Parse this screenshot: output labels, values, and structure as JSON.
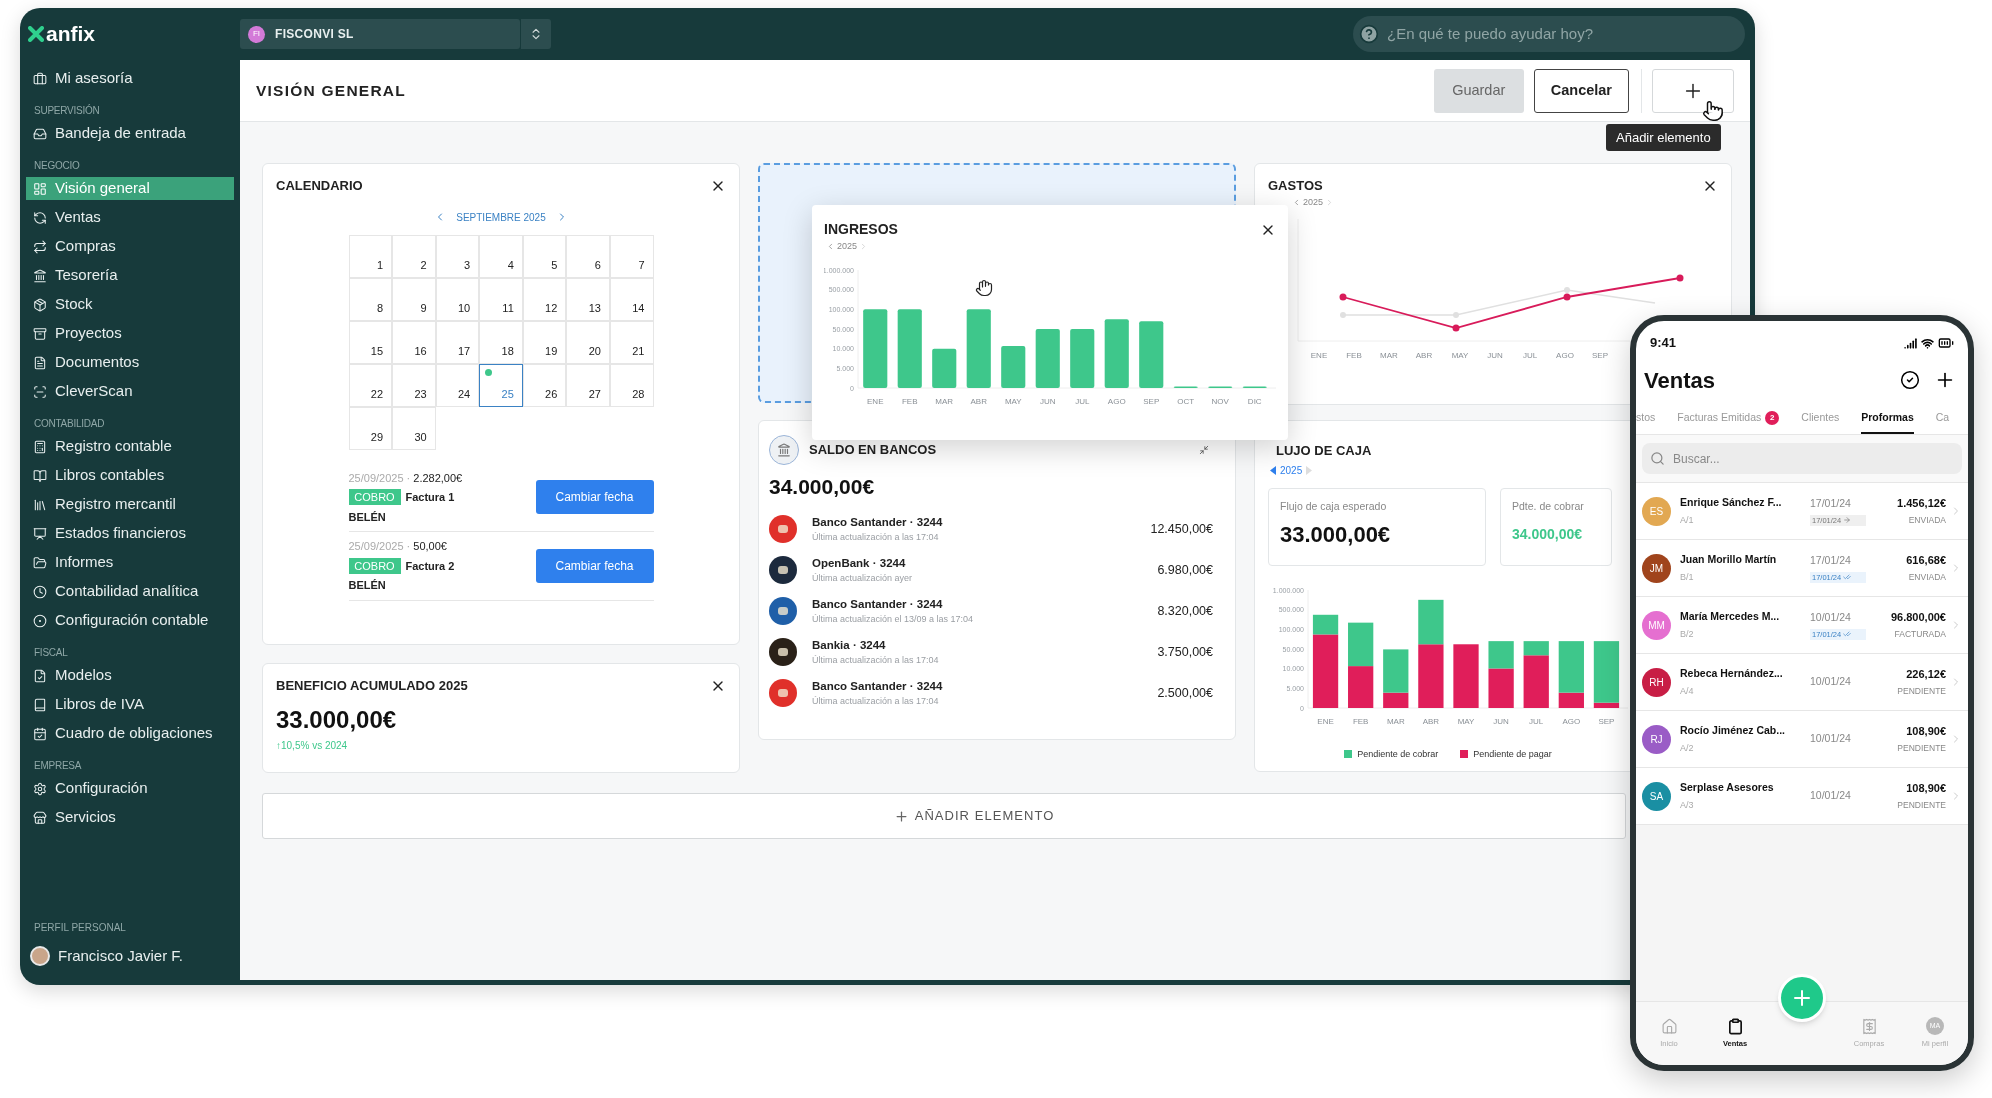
{
  "topbar": {
    "logo": "anfix",
    "company": {
      "initials": "FI",
      "name": "FISCONVI SL"
    },
    "assistant": {
      "placeholder": "¿En qué te puedo ayudar hoy?"
    }
  },
  "sidebar": {
    "sections": [
      {
        "items": [
          {
            "label": "Mi asesoría",
            "selected": false
          }
        ]
      },
      {
        "title": "SUPERVISIÓN",
        "items": [
          {
            "label": "Bandeja de entrada",
            "selected": false
          }
        ]
      },
      {
        "title": "NEGOCIO",
        "items": [
          {
            "label": "Visión general",
            "selected": true
          },
          {
            "label": "Ventas",
            "selected": false
          },
          {
            "label": "Compras",
            "selected": false
          },
          {
            "label": "Tesorería",
            "selected": false
          },
          {
            "label": "Stock",
            "selected": false
          },
          {
            "label": "Proyectos",
            "selected": false
          },
          {
            "label": "Documentos",
            "selected": false
          },
          {
            "label": "CleverScan",
            "selected": false
          }
        ]
      },
      {
        "title": "CONTABILIDAD",
        "items": [
          {
            "label": "Registro contable",
            "selected": false
          },
          {
            "label": "Libros contables",
            "selected": false
          },
          {
            "label": "Registro mercantil",
            "selected": false
          },
          {
            "label": "Estados financieros",
            "selected": false
          },
          {
            "label": "Informes",
            "selected": false
          },
          {
            "label": "Contabilidad analítica",
            "selected": false
          },
          {
            "label": "Configuración contable",
            "selected": false
          }
        ]
      },
      {
        "title": "FISCAL",
        "items": [
          {
            "label": "Modelos",
            "selected": false
          },
          {
            "label": "Libros de IVA",
            "selected": false
          },
          {
            "label": "Cuadro de obligaciones",
            "selected": false
          }
        ]
      },
      {
        "title": "EMPRESA",
        "items": [
          {
            "label": "Configuración",
            "selected": false
          },
          {
            "label": "Servicios",
            "selected": false
          }
        ]
      }
    ],
    "profile": {
      "title": "PERFIL PERSONAL",
      "name": "Francisco Javier F."
    }
  },
  "header": {
    "title": "VISIÓN GENERAL",
    "buttons": [
      {
        "label": "Guardar",
        "disabled": true
      },
      {
        "label": "Cancelar",
        "disabled": false
      }
    ],
    "tooltip": "Añadir elemento"
  },
  "calendar": {
    "title": "CALENDARIO",
    "month": "SEPTIEMBRE 2025",
    "days": [
      {
        "day": "1",
        "selected": false,
        "has_event": false
      },
      {
        "day": "2",
        "selected": false,
        "has_event": false
      },
      {
        "day": "3",
        "selected": false,
        "has_event": false
      },
      {
        "day": "4",
        "selected": false,
        "has_event": false
      },
      {
        "day": "5",
        "selected": false,
        "has_event": false
      },
      {
        "day": "6",
        "selected": false,
        "has_event": false
      },
      {
        "day": "7",
        "selected": false,
        "has_event": false
      },
      {
        "day": "8",
        "selected": false,
        "has_event": false
      },
      {
        "day": "9",
        "selected": false,
        "has_event": false
      },
      {
        "day": "10",
        "selected": false,
        "has_event": false
      },
      {
        "day": "11",
        "selected": false,
        "has_event": false
      },
      {
        "day": "12",
        "selected": false,
        "has_event": false
      },
      {
        "day": "13",
        "selected": false,
        "has_event": false
      },
      {
        "day": "14",
        "selected": false,
        "has_event": false
      },
      {
        "day": "15",
        "selected": false,
        "has_event": false
      },
      {
        "day": "16",
        "selected": false,
        "has_event": false
      },
      {
        "day": "17",
        "selected": false,
        "has_event": false
      },
      {
        "day": "18",
        "selected": false,
        "has_event": false
      },
      {
        "day": "19",
        "selected": false,
        "has_event": false
      },
      {
        "day": "20",
        "selected": false,
        "has_event": false
      },
      {
        "day": "21",
        "selected": false,
        "has_event": false
      },
      {
        "day": "22",
        "selected": false,
        "has_event": false
      },
      {
        "day": "23",
        "selected": false,
        "has_event": false
      },
      {
        "day": "24",
        "selected": false,
        "has_event": false
      },
      {
        "day": "25",
        "selected": true,
        "has_event": true
      },
      {
        "day": "26",
        "selected": false,
        "has_event": false
      },
      {
        "day": "27",
        "selected": false,
        "has_event": false
      },
      {
        "day": "28",
        "selected": false,
        "has_event": false
      },
      {
        "day": "29",
        "selected": false,
        "has_event": false
      },
      {
        "day": "30",
        "selected": false,
        "has_event": false
      }
    ],
    "events": [
      {
        "date": "25/09/2025 ·",
        "amount": "2.282,00€",
        "tag": "COBRO",
        "title": "Factura 1",
        "person": "BELÉN",
        "button": "Cambiar fecha"
      },
      {
        "date": "25/09/2025 ·",
        "amount": "50,00€",
        "tag": "COBRO",
        "title": "Factura 2",
        "person": "BELÉN",
        "button": "Cambiar fecha"
      }
    ]
  },
  "beneficio": {
    "title": "BENEFICIO ACUMULADO 2025",
    "amount": "33.000,00€",
    "change": "↑10,5% vs 2024"
  },
  "ingresos": {
    "title": "INGRESOS",
    "year": "2025",
    "y_labels": [
      "1.000.000",
      "500.000",
      "100.000",
      "50.000",
      "10.000",
      "5.000",
      "0"
    ],
    "months": [
      "ENE",
      "FEB",
      "MAR",
      "ABR",
      "MAY",
      "JUN",
      "JUL",
      "AGO",
      "SEP",
      "OCT",
      "NOV",
      "DIC"
    ]
  },
  "saldo": {
    "title": "SALDO EN BANCOS",
    "total": "34.000,00€",
    "accounts": [
      {
        "name": "Banco Santander · 3244",
        "updated": "Última actualización a las 17:04",
        "amount": "12.450,00€",
        "color": "#e0302a"
      },
      {
        "name": "OpenBank · 3244",
        "updated": "Última actualización ayer",
        "amount": "6.980,00€",
        "color": "#1c2a3d"
      },
      {
        "name": "Banco Santander · 3244",
        "updated": "Última actualización el 13/09 a las 17:04",
        "amount": "8.320,00€",
        "color": "#1f5fa8"
      },
      {
        "name": "Bankia · 3244",
        "updated": "Última actualización a las 17:04",
        "amount": "3.750,00€",
        "color": "#2a2118"
      },
      {
        "name": "Banco Santander · 3244",
        "updated": "Última actualización a las 17:04",
        "amount": "2.500,00€",
        "color": "#e0302a"
      }
    ]
  },
  "gastos": {
    "title": "GASTOS",
    "year": "2025",
    "months": [
      "ENE",
      "FEB",
      "MAR",
      "ABR",
      "MAY",
      "JUN",
      "JUL",
      "AGO",
      "SEP"
    ]
  },
  "flujo": {
    "title": "LUJO DE CAJA",
    "year": "2025",
    "kpis": [
      {
        "label": "Flujo de caja esperado",
        "value": "33.000,00€",
        "kind": "neutral"
      },
      {
        "label": "Pdte. de cobrar",
        "value": "34.000,00€",
        "kind": "positive"
      }
    ],
    "y_labels": [
      "1.000.000",
      "500.000",
      "100.000",
      "50.000",
      "10.000",
      "5.000",
      "0"
    ],
    "months": [
      "ENE",
      "FEB",
      "MAR",
      "ABR",
      "MAY",
      "JUN",
      "JUL",
      "AGO",
      "SEP"
    ],
    "legend": [
      {
        "label": "Pendiente de cobrar",
        "color": "#3ec78b"
      },
      {
        "label": "Pendiente de pagar",
        "color": "#e01e5a"
      }
    ]
  },
  "add_widget": {
    "label": "AÑADIR ELEMENTO"
  },
  "phone": {
    "time": "9:41",
    "title": "Ventas",
    "tabs": [
      {
        "label": "stos",
        "selected": false
      },
      {
        "label": "Facturas Emitidas",
        "badge": "2",
        "selected": false
      },
      {
        "label": "Clientes",
        "selected": false
      },
      {
        "label": "Proformas",
        "selected": true
      },
      {
        "label": "Ca",
        "selected": false
      }
    ],
    "search": {
      "placeholder": "Buscar..."
    },
    "rows": [
      {
        "initials": "ES",
        "color": "#e2a852",
        "name": "Enrique Sánchez F...",
        "code": "A/1",
        "date": "17/01/24",
        "chip": {
          "date": "17/01/24",
          "kind": "arrow"
        },
        "amount": "1.456,12€",
        "status": "ENVIADA"
      },
      {
        "initials": "JM",
        "color": "#a0441c",
        "name": "Juan Morillo Martín",
        "code": "B/1",
        "date": "17/01/24",
        "chip": {
          "date": "17/01/24",
          "kind": "check"
        },
        "amount": "616,68€",
        "status": "ENVIADA"
      },
      {
        "initials": "MM",
        "color": "#e56fd0",
        "name": "María Mercedes M...",
        "code": "B/2",
        "date": "10/01/24",
        "chip": {
          "date": "17/01/24",
          "kind": "check"
        },
        "amount": "96.800,00€",
        "status": "FACTURADA"
      },
      {
        "initials": "RH",
        "color": "#c81e45",
        "name": "Rebeca Hernández...",
        "code": "A/4",
        "date": "10/01/24",
        "amount": "226,12€",
        "status": "PENDIENTE"
      },
      {
        "initials": "RJ",
        "color": "#9a5cc6",
        "name": "Rocío Jiménez Cab...",
        "code": "A/2",
        "date": "10/01/24",
        "amount": "108,90€",
        "status": "PENDIENTE"
      },
      {
        "initials": "SA",
        "color": "#1a8fa3",
        "name": "Serplase Asesores",
        "code": "A/3",
        "date": "10/01/24",
        "amount": "108,90€",
        "status": "PENDIENTE"
      }
    ],
    "nav": [
      {
        "label": "Inicio",
        "selected": false
      },
      {
        "label": "Ventas",
        "selected": true
      },
      {
        "label": "Compras",
        "selected": false
      },
      {
        "label": "Mi perfil",
        "selected": false,
        "initials": "MA"
      }
    ]
  }
}
